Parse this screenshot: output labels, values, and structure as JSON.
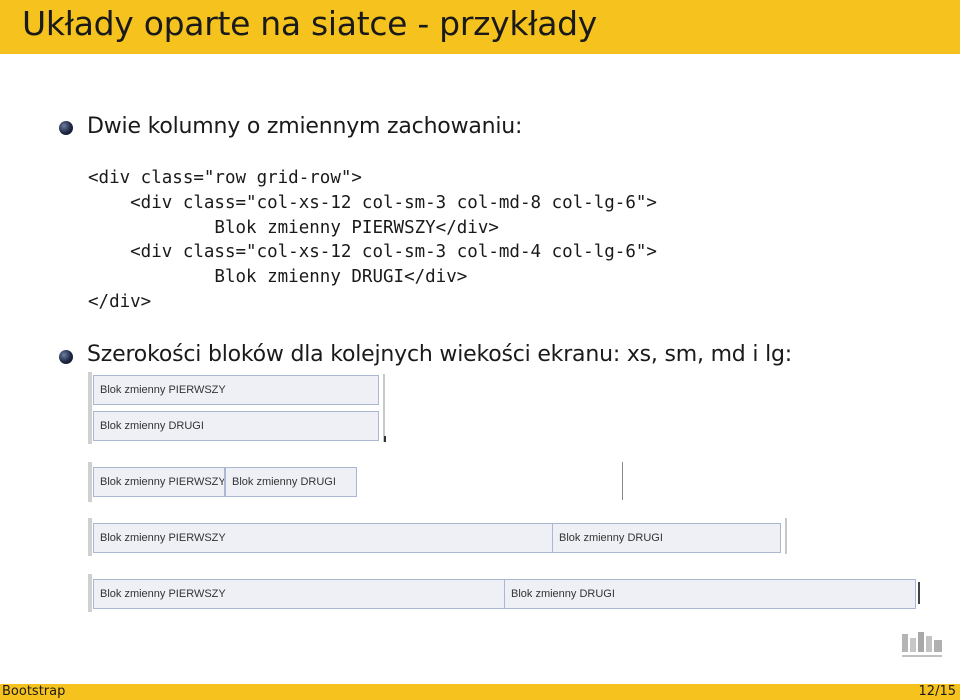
{
  "slide": {
    "title": "Układy oparte na siatce - przykłady",
    "bullets": [
      "Dwie kolumny o zmiennym zachowaniu:",
      "Szerokości bloków dla kolejnych wiekości ekranu: xs, sm, md i lg:"
    ],
    "code_lines": [
      "<div class=\"row grid-row\">",
      "    <div class=\"col-xs-12 col-sm-3 col-md-8 col-lg-6\">",
      "            Blok zmienny PIERWSZY</div>",
      "    <div class=\"col-xs-12 col-sm-3 col-md-4 col-lg-6\">",
      "            Blok zmienny DRUGI</div>",
      "</div>"
    ],
    "block_labels": {
      "first": "Blok zmienny PIERWSZY",
      "second": "Blok zmienny DRUGI"
    },
    "screen_sizes": [
      "xs",
      "sm",
      "md",
      "lg"
    ]
  },
  "footer": {
    "left": "Bootstrap",
    "page": "12/15"
  },
  "colors": {
    "accent": "#f6c31e",
    "block_fill": "#eef0f5",
    "block_border": "#aab8d2"
  }
}
